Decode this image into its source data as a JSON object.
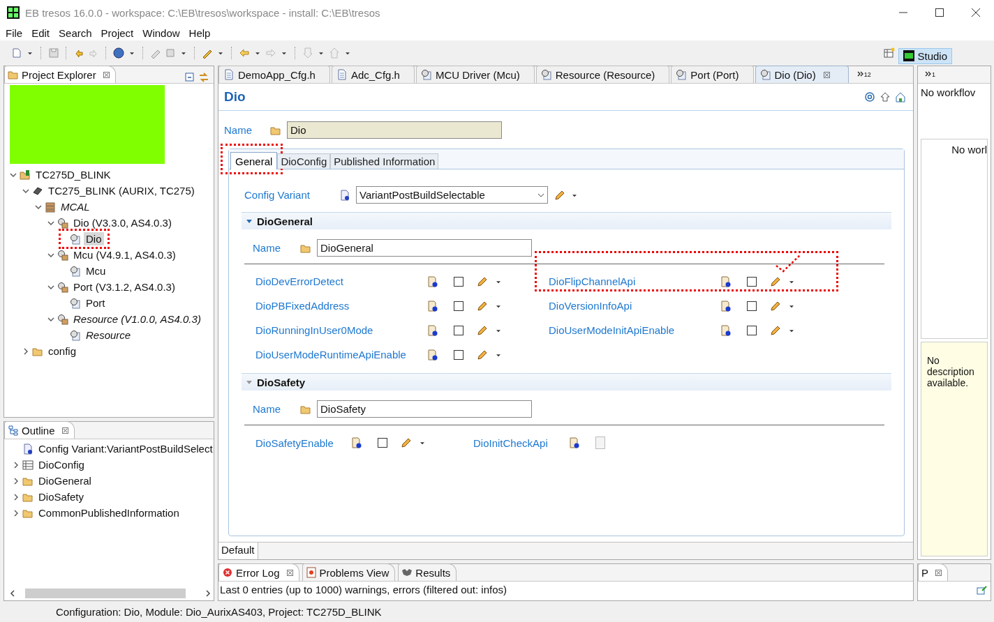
{
  "window": {
    "title": "EB tresos 16.0.0 - workspace: C:\\EB\\tresos\\workspace - install: C:\\EB\\tresos"
  },
  "menu": [
    "File",
    "Edit",
    "Search",
    "Project",
    "Window",
    "Help"
  ],
  "perspective": {
    "label": "Studio",
    "selected": true
  },
  "project_explorer": {
    "title": "Project Explorer",
    "redacted": true,
    "tree": [
      {
        "label": "TC275D_BLINK",
        "kind": "project",
        "expanded": true,
        "italic": false,
        "selected": false,
        "children": [
          {
            "label": "TC275_BLINK (AURIX, TC275)",
            "kind": "chip",
            "expanded": true,
            "italic": false,
            "selected": false,
            "children": [
              {
                "label": "MCAL",
                "kind": "stack",
                "expanded": true,
                "italic": true,
                "selected": false,
                "children": [
                  {
                    "label": "Dio (V3.3.0, AS4.0.3)",
                    "kind": "module",
                    "expanded": true,
                    "italic": false,
                    "selected": false,
                    "children": [
                      {
                        "label": "Dio",
                        "kind": "config",
                        "italic": false,
                        "selected": true,
                        "highlighted": true
                      }
                    ]
                  },
                  {
                    "label": "Mcu (V4.9.1, AS4.0.3)",
                    "kind": "module",
                    "expanded": true,
                    "italic": false,
                    "selected": false,
                    "children": [
                      {
                        "label": "Mcu",
                        "kind": "config",
                        "italic": false,
                        "selected": false
                      }
                    ]
                  },
                  {
                    "label": "Port (V3.1.2, AS4.0.3)",
                    "kind": "module",
                    "expanded": true,
                    "italic": false,
                    "selected": false,
                    "children": [
                      {
                        "label": "Port",
                        "kind": "config",
                        "italic": false,
                        "selected": false
                      }
                    ]
                  },
                  {
                    "label": "Resource (V1.0.0, AS4.0.3)",
                    "kind": "module",
                    "expanded": true,
                    "italic": true,
                    "selected": false,
                    "children": [
                      {
                        "label": "Resource",
                        "kind": "config",
                        "italic": true,
                        "selected": false
                      }
                    ]
                  }
                ]
              }
            ]
          },
          {
            "label": "config",
            "kind": "folder",
            "expanded": false,
            "italic": false,
            "selected": false
          }
        ]
      }
    ]
  },
  "outline": {
    "title": "Outline",
    "items": [
      {
        "label": "Config Variant:VariantPostBuildSelect",
        "kind": "doc",
        "expandable": false
      },
      {
        "label": "DioConfig",
        "kind": "table",
        "expandable": true
      },
      {
        "label": "DioGeneral",
        "kind": "folder",
        "expandable": true
      },
      {
        "label": "DioSafety",
        "kind": "folder",
        "expandable": true
      },
      {
        "label": "CommonPublishedInformation",
        "kind": "folder",
        "expandable": true
      }
    ]
  },
  "editor_tabs": [
    {
      "label": "DemoApp_Cfg.h",
      "kind": "file",
      "selected": false
    },
    {
      "label": "Adc_Cfg.h",
      "kind": "file",
      "selected": false
    },
    {
      "label": "MCU Driver (Mcu)",
      "kind": "config",
      "selected": false
    },
    {
      "label": "Resource (Resource)",
      "kind": "config",
      "selected": false
    },
    {
      "label": "Port (Port)",
      "kind": "config",
      "selected": false
    },
    {
      "label": "Dio (Dio)",
      "kind": "config",
      "selected": true
    }
  ],
  "editor_tabs_overflow": "12",
  "editor": {
    "title": "Dio",
    "name_label": "Name",
    "name_value": "Dio",
    "tabs": [
      {
        "label": "General",
        "selected": true,
        "highlighted": true
      },
      {
        "label": "DioConfig",
        "selected": false
      },
      {
        "label": "Published Information",
        "selected": false
      }
    ],
    "config_variant": {
      "label": "Config Variant",
      "value": "VariantPostBuildSelectable"
    },
    "sections": [
      {
        "title": "DioGeneral",
        "expanded": true,
        "name_label": "Name",
        "name_value": "DioGeneral",
        "params": [
          {
            "label": "DioDevErrorDetect",
            "checked": false,
            "disabled": false
          },
          {
            "label": "DioFlipChannelApi",
            "checked": false,
            "disabled": false,
            "highlighted": true
          },
          {
            "label": "DioPBFixedAddress",
            "checked": false,
            "disabled": false
          },
          {
            "label": "DioVersionInfoApi",
            "checked": false,
            "disabled": false
          },
          {
            "label": "DioRunningInUser0Mode",
            "checked": false,
            "disabled": false
          },
          {
            "label": "DioUserModeInitApiEnable",
            "checked": false,
            "disabled": false
          },
          {
            "label": "DioUserModeRuntimeApiEnable",
            "checked": false,
            "disabled": false
          }
        ]
      },
      {
        "title": "DioSafety",
        "expanded": true,
        "name_label": "Name",
        "name_value": "DioSafety",
        "params": [
          {
            "label": "DioSafetyEnable",
            "checked": false,
            "disabled": false
          },
          {
            "label": "DioInitCheckApi",
            "checked": false,
            "disabled": true
          }
        ]
      }
    ],
    "variant_tab": "Default"
  },
  "error_log": {
    "tabs": [
      {
        "label": "Error Log",
        "kind": "error",
        "selected": true
      },
      {
        "label": "Problems View",
        "kind": "problems",
        "selected": false
      },
      {
        "label": "Results",
        "kind": "results",
        "selected": false
      }
    ],
    "message": "Last 0 entries (up to 1000) warnings, errors (filtered out: infos)"
  },
  "workflow": {
    "overflow": "1",
    "title": "No workflov",
    "list_text": "No worl",
    "description": "No description available."
  },
  "mini_panel": {
    "title": "P"
  },
  "status_bar": "Configuration: Dio, Module: Dio_AurixAS403, Project: TC275D_BLINK"
}
